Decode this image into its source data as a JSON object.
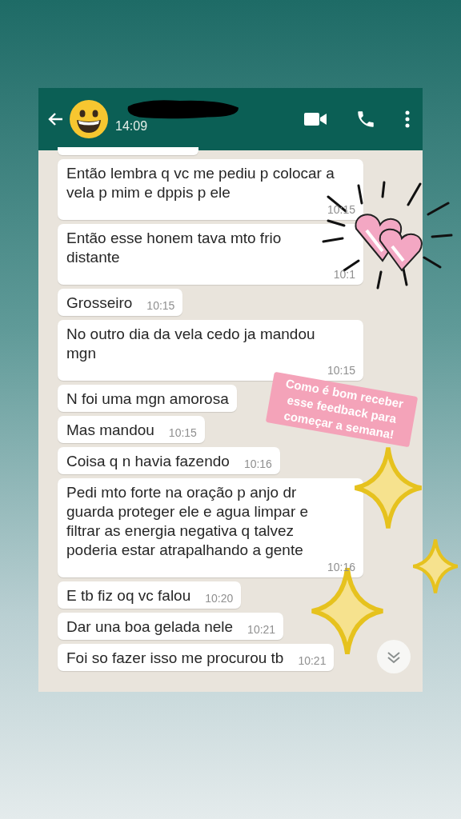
{
  "header": {
    "status": "14:09"
  },
  "messages": [
    {
      "text": "Então lembra q vc me pediu p colocar a vela p mim e dppis p ele",
      "time": "10:15"
    },
    {
      "text": "Então esse honem tava mto frio distante",
      "time": "10:1"
    },
    {
      "text": "Grosseiro",
      "time": "10:15"
    },
    {
      "text": "No outro dia da vela cedo ja mandou mgn",
      "time": "10:15"
    },
    {
      "text": "N foi uma mgn amorosa"
    },
    {
      "text": "Mas mandou",
      "time": "10:15"
    },
    {
      "text": "Coisa q n havia fazendo",
      "time": "10:16"
    },
    {
      "text": "Pedi mto forte na oração p anjo dr guarda proteger ele e agua limpar e filtrar as energia negativa q talvez poderia estar atrapalhando a gente",
      "time": "10:16"
    },
    {
      "text": "E tb fiz oq vc falou",
      "time": "10:20"
    },
    {
      "text": "Dar una boa gelada nele",
      "time": "10:21"
    },
    {
      "text": "Foi so fazer isso me procurou tb",
      "time": "10:21"
    }
  ],
  "sticker": {
    "caption": "Como é bom receber esse feedback para começar a semana!"
  }
}
